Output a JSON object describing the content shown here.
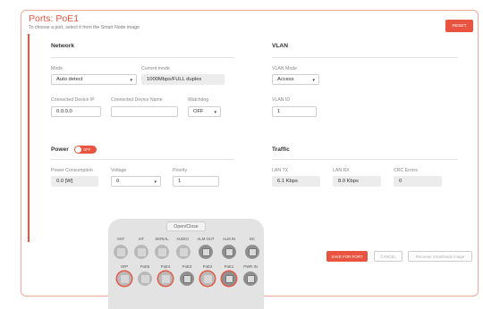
{
  "header": {
    "title": "Ports: PoE1",
    "subtitle": "To choose a port, select it from the Smart Node image",
    "reset_label": "RESET"
  },
  "network": {
    "section_title": "Network",
    "mode_label": "Mode",
    "mode_value": "Auto detect",
    "current_mode_label": "Current mode",
    "current_mode_value": "1000Mbps/FULL duplex",
    "connected_ip_label": "Connected Device IP",
    "connected_ip_value": "0.0.0.0",
    "connected_name_label": "Connected Device Name",
    "connected_name_value": "",
    "watchdog_label": "Watchdog",
    "watchdog_value": "OFF"
  },
  "vlan": {
    "section_title": "VLAN",
    "mode_label": "VLAN Mode",
    "mode_value": "Access",
    "id_label": "VLAN ID",
    "id_value": "1"
  },
  "power": {
    "section_title": "Power",
    "toggle_label": "OFF",
    "consumption_label": "Power Consumption",
    "consumption_value": "0.0 [W]",
    "voltage_label": "Voltage",
    "voltage_value": "0",
    "priority_label": "Priority",
    "priority_value": "1"
  },
  "traffic": {
    "section_title": "Traffic",
    "lan_tx_label": "LAN TX",
    "lan_tx_value": "6.1 Kbps",
    "lan_rx_label": "LAN RX",
    "lan_rx_value": "8.0 Kbps",
    "crc_label": "CRC Errors",
    "crc_value": "0"
  },
  "device": {
    "open_close_label": "Open/Close",
    "top_ports": [
      "ANT",
      "IAT",
      "SERIAL",
      "AUDIO",
      "ALM OUT",
      "ALM IN",
      "DC"
    ],
    "bottom_ports": [
      "SFP",
      "PoE5",
      "PoE4",
      "PoE3",
      "PoE2",
      "PoE1",
      "PWR IN"
    ]
  },
  "actions": {
    "save_label": "SAVE FOR PORT",
    "cancel_label": "CANCEL",
    "recenter_label": "Recenter SmartNode image"
  },
  "colors": {
    "accent": "#e8543f",
    "readonly_bg": "#ececec"
  }
}
